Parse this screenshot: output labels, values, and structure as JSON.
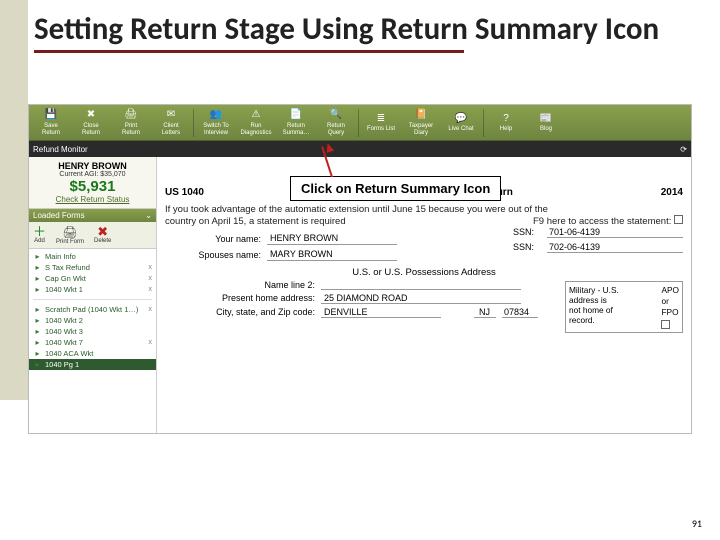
{
  "slide": {
    "title": "Setting Return Stage Using Return Summary Icon",
    "page_number": "91",
    "callout": "Click on Return Summary Icon"
  },
  "toolbar": {
    "buttons": [
      {
        "label": "Save\nReturn",
        "icon": "💾"
      },
      {
        "label": "Close\nReturn",
        "icon": "✖"
      },
      {
        "label": "Print\nReturn",
        "icon": "🖨"
      },
      {
        "label": "Client\nLetters",
        "icon": "✉"
      },
      {
        "label": "Switch To\nInterview",
        "icon": "👥"
      },
      {
        "label": "Run\nDiagnostics",
        "icon": "⚠"
      },
      {
        "label": "Return\nSumma…",
        "icon": "📄"
      },
      {
        "label": "Return\nQuery",
        "icon": "🔍"
      },
      {
        "label": "Forms List",
        "icon": "≣"
      },
      {
        "label": "Taxpayer\nDiary",
        "icon": "📔"
      },
      {
        "label": "Live Chat",
        "icon": "💬"
      },
      {
        "label": "Help",
        "icon": "?"
      },
      {
        "label": "Blog",
        "icon": "📰"
      }
    ]
  },
  "status": {
    "label": "Refund Monitor",
    "icon": "⟳"
  },
  "taxpayer": {
    "name": "HENRY BROWN",
    "agi_label": "Current AGI: $35,070",
    "refund": "$5,931",
    "check_link": "Check Return Status"
  },
  "forms_panel": {
    "header": "Loaded Forms",
    "add": "Add",
    "print": "Print Form",
    "delete": "Delete",
    "items_a": [
      {
        "label": "Main Info",
        "x": ""
      },
      {
        "label": "S Tax Refund",
        "x": "x"
      },
      {
        "label": "Cap Gn Wkt",
        "x": "x"
      },
      {
        "label": "1040 Wkt 1",
        "x": "x"
      }
    ],
    "items_b": [
      {
        "label": "Scratch Pad (1040 Wkt 1…)",
        "x": "x"
      },
      {
        "label": "1040 Wkt 2",
        "x": ""
      },
      {
        "label": "1040 Wkt 3",
        "x": ""
      },
      {
        "label": "1040 Wkt 7",
        "x": "x"
      },
      {
        "label": "1040 ACA Wkt",
        "x": ""
      },
      {
        "label": "1040 Pg 1",
        "x": "",
        "sel": true
      }
    ]
  },
  "form": {
    "left_title": "US 1040",
    "center_title": "U.S. Individual Income Tax Return",
    "year": "2014",
    "note_line1": "If you took advantage of the automatic extension until June 15 because you were out of the",
    "note_line2_left": "country on April 15,  a statement is required",
    "note_line2_right": "F9 here to access the statement:",
    "your_name_lbl": "Your name:",
    "your_name": "HENRY BROWN",
    "spouse_name_lbl": "Spouses name:",
    "spouse_name": "MARY BROWN",
    "ssn_lbl": "SSN:",
    "ssn1": "701-06-4139",
    "ssn2": "702-06-4139",
    "addr_title": "U.S. or U.S. Possessions Address",
    "name_line2_lbl": "Name line 2:",
    "name_line2": "",
    "home_lbl": "Present home address:",
    "home": "25 DIAMOND ROAD",
    "csz_lbl": "City,  state,  and Zip code:",
    "city": "DENVILLE",
    "state": "NJ",
    "zip": "07834",
    "mil_text": "Military - U.S.\naddress is\nnot home of\nrecord.",
    "mil_apo": "APO",
    "mil_or": "or",
    "mil_fpo": "FPO"
  }
}
